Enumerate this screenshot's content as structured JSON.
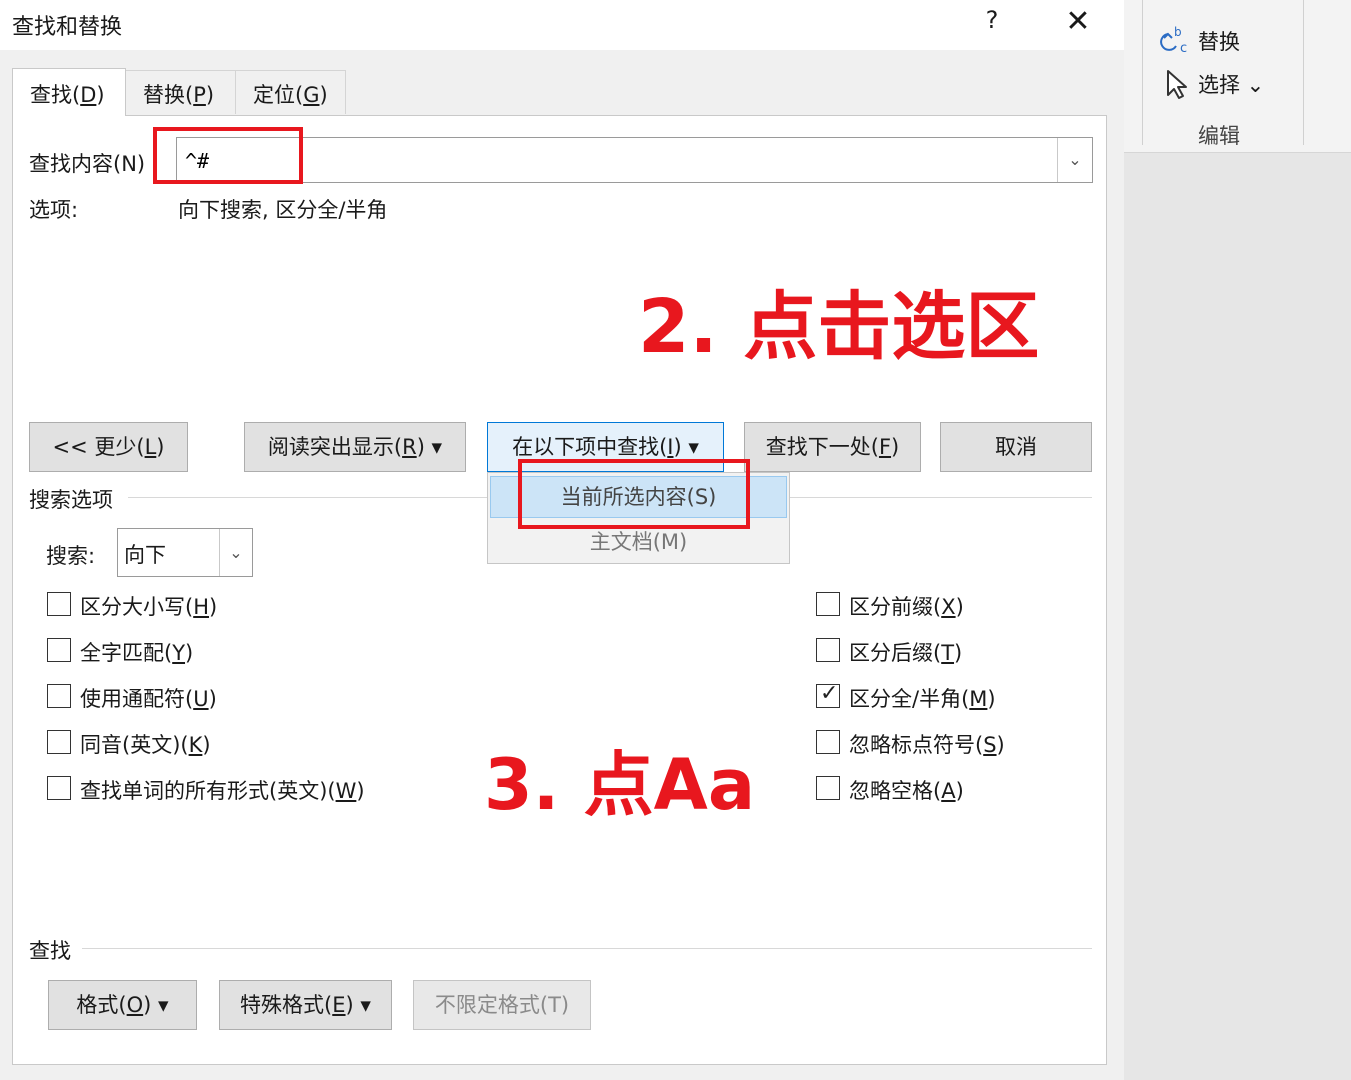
{
  "dialog": {
    "title": "查找和替换",
    "help_label": "?",
    "close_label": "✕",
    "tabs": [
      {
        "label": "查找(",
        "key": "D",
        "end": ")"
      },
      {
        "label": "替换(",
        "key": "P",
        "end": ")"
      },
      {
        "label": "定位(",
        "key": "G",
        "end": ")"
      }
    ],
    "find_label": "查找内容(N)",
    "find_value": "^#",
    "options_label": "选项:",
    "options_value": "向下搜索, 区分全/半角",
    "buttons": {
      "less": {
        "label": "<< 更少(",
        "key": "L",
        "end": ")"
      },
      "reading_highlight": {
        "label": "阅读突出显示(",
        "key": "R",
        "end": ") ▾"
      },
      "find_in": {
        "label": "在以下项中查找(",
        "key": "I",
        "end": ") ▾"
      },
      "find_next": {
        "label": "查找下一处(",
        "key": "F",
        "end": ")"
      },
      "cancel": {
        "label": "取消"
      }
    },
    "find_in_menu": [
      "当前所选内容(S)",
      "主文档(M)"
    ],
    "search_options_label": "搜索选项",
    "direction_label": "搜索:",
    "direction_value": "向下",
    "left_checkboxes": [
      {
        "label": "区分大小写(",
        "key": "H",
        "end": ")",
        "checked": false
      },
      {
        "label": "全字匹配(",
        "key": "Y",
        "end": ")",
        "checked": false
      },
      {
        "label": "使用通配符(",
        "key": "U",
        "end": ")",
        "checked": false
      },
      {
        "label": "同音(英文)(",
        "key": "K",
        "end": ")",
        "checked": false
      },
      {
        "label": "查找单词的所有形式(英文)(",
        "key": "W",
        "end": ")",
        "checked": false
      }
    ],
    "right_checkboxes": [
      {
        "label": "区分前缀(",
        "key": "X",
        "end": ")",
        "checked": false
      },
      {
        "label": "区分后缀(",
        "key": "T",
        "end": ")",
        "checked": false
      },
      {
        "label": "区分全/半角(",
        "key": "M",
        "end": ")",
        "checked": true
      },
      {
        "label": "忽略标点符号(",
        "key": "S",
        "end": ")",
        "checked": false
      },
      {
        "label": "忽略空格(",
        "key": "A",
        "end": ")",
        "checked": false
      }
    ],
    "find_group_label": "查找",
    "format_buttons": {
      "format": {
        "label": "格式(",
        "key": "O",
        "end": ") ▾"
      },
      "special": {
        "label": "特殊格式(",
        "key": "E",
        "end": ") ▾"
      },
      "no_format": {
        "label": "不限定格式(T)"
      }
    }
  },
  "annotations": {
    "step2": "2. 点击选区",
    "step3": "3. 点Aa",
    "accent_color": "#e8171e"
  },
  "ribbon": {
    "replace_label": "替换",
    "select_label": "选择 ⌄",
    "group_label": "编辑"
  }
}
